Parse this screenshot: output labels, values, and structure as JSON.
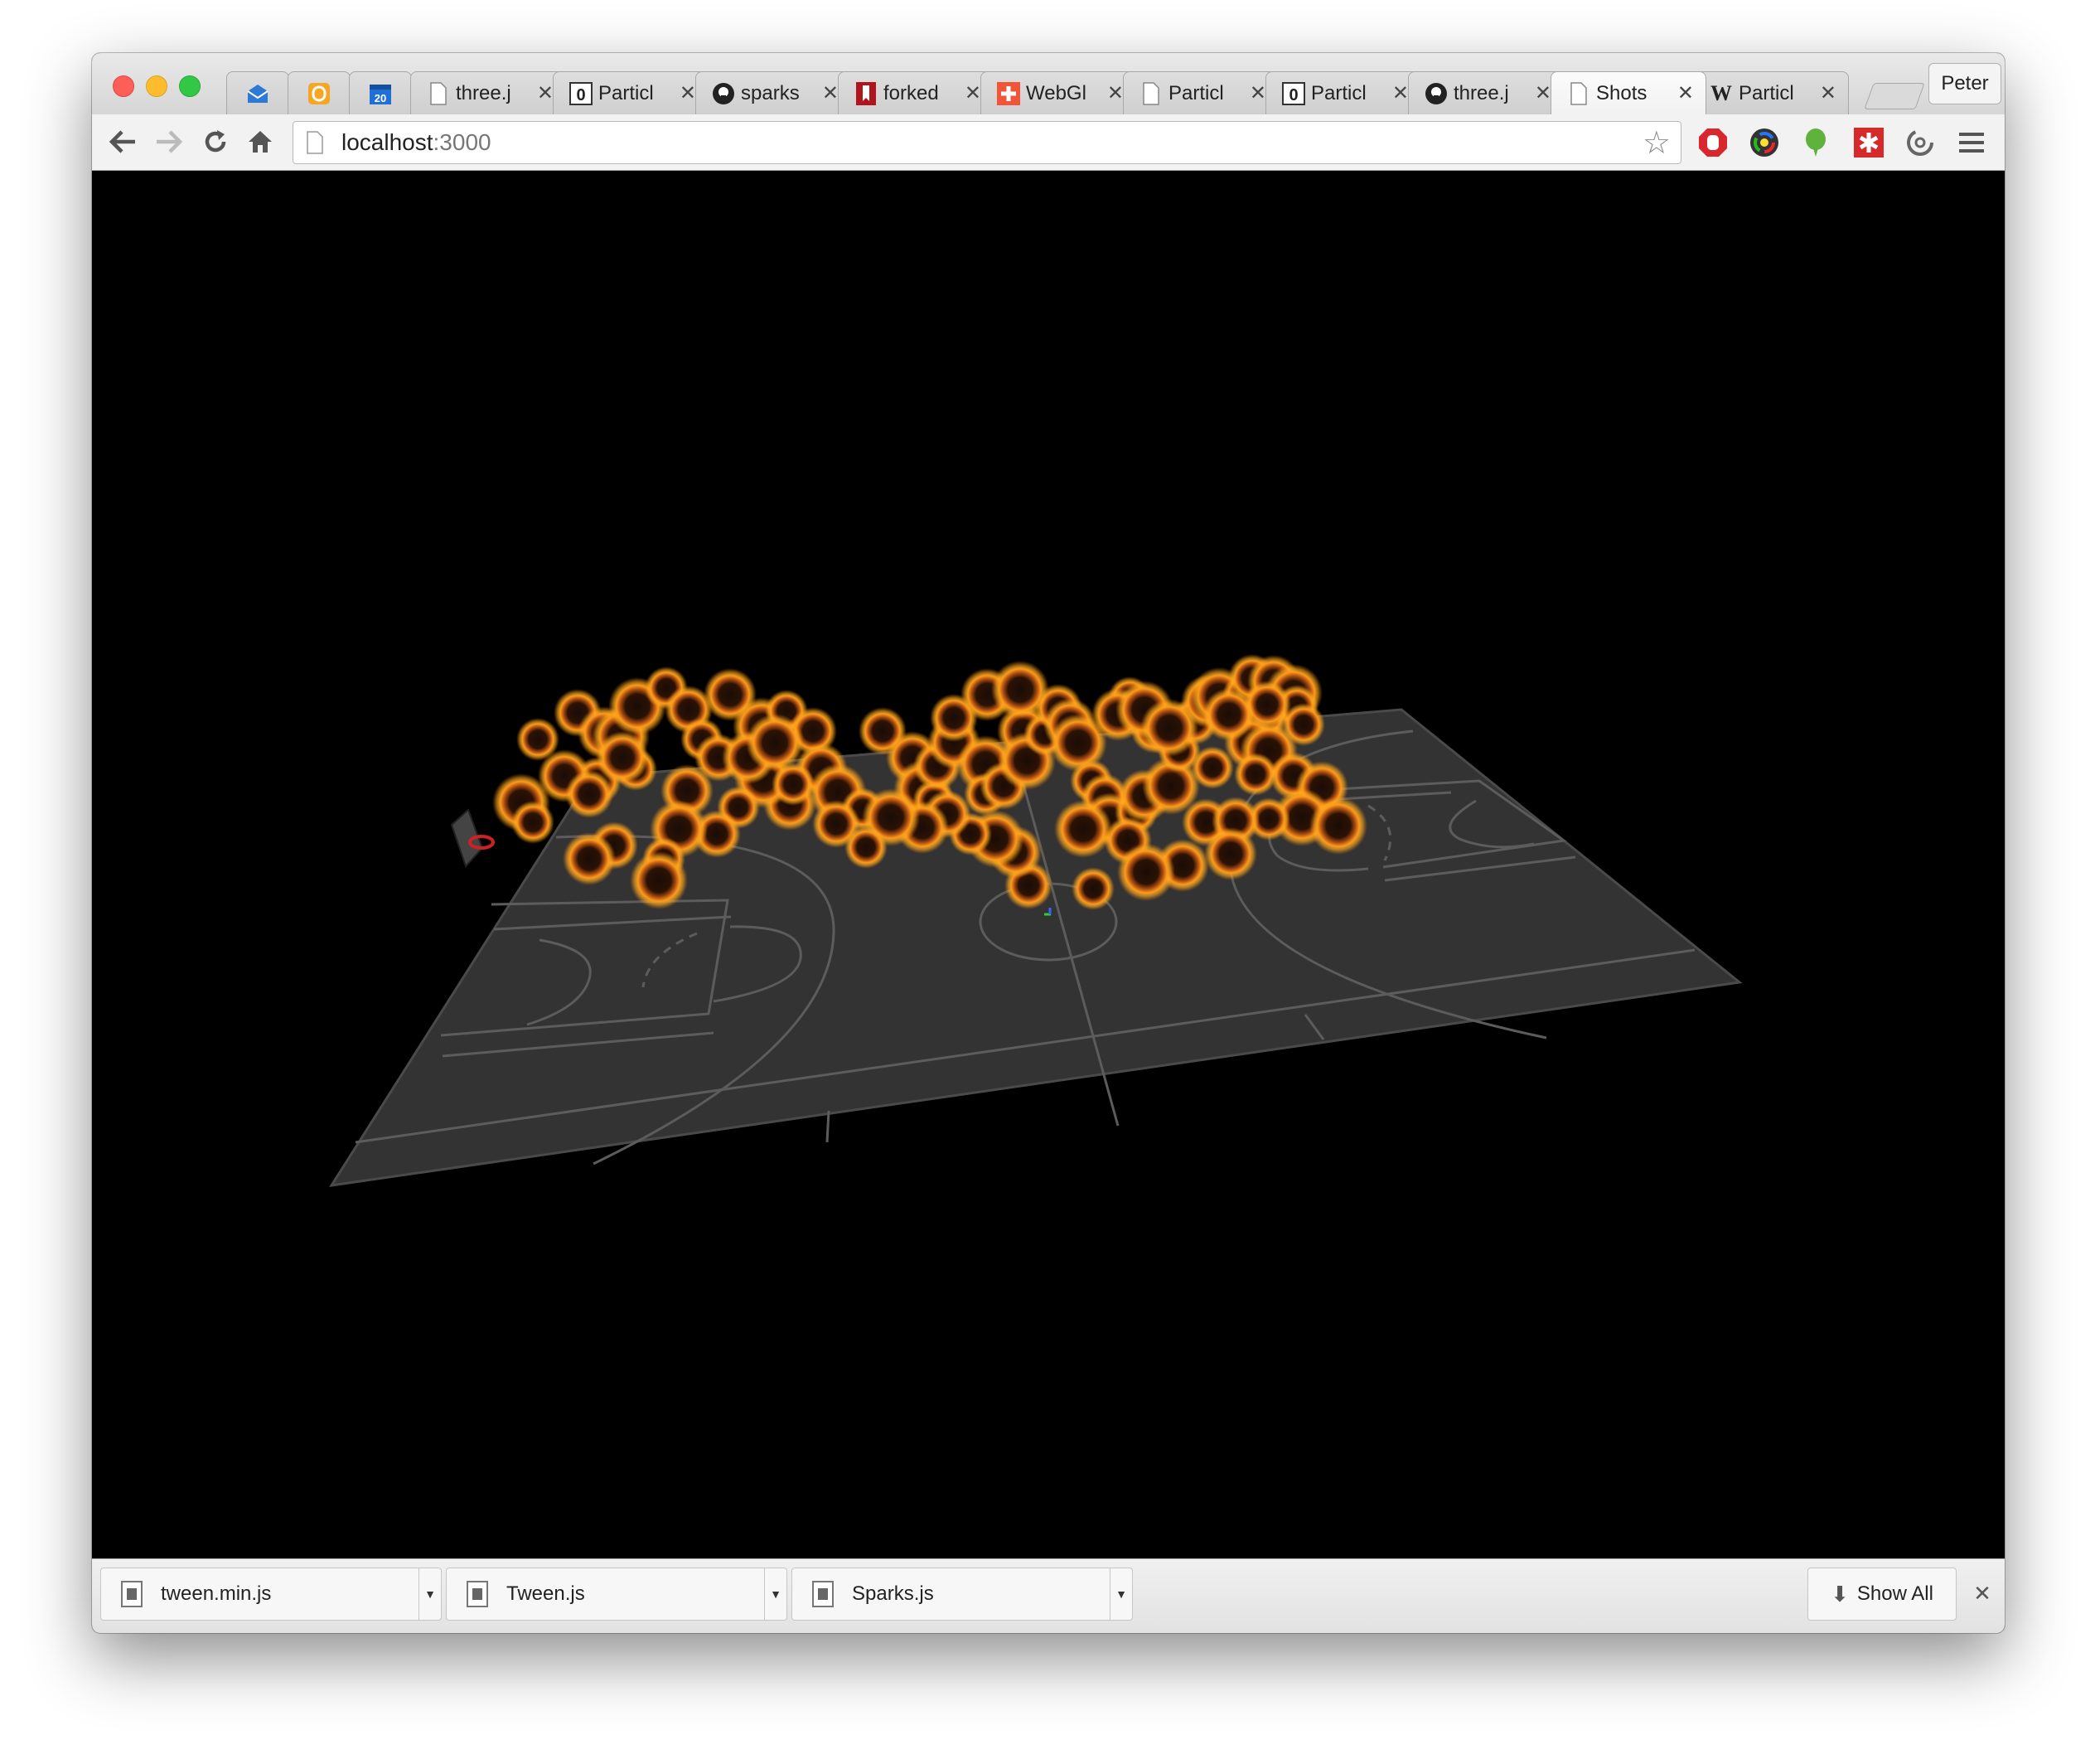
{
  "window": {
    "title": "Shots"
  },
  "tabs": [
    {
      "label": "",
      "icon": "mailbox-icon",
      "pinned": true,
      "color": "#2d7ad6"
    },
    {
      "label": "",
      "icon": "feedly-icon",
      "pinned": true,
      "color": "#f5a623"
    },
    {
      "label": "",
      "icon": "calendar-icon",
      "pinned": true,
      "color": "#1f6fd6",
      "badge": "20"
    },
    {
      "label": "three.j",
      "icon": "page-icon"
    },
    {
      "label": "Particl",
      "icon": "zero-icon"
    },
    {
      "label": "sparks",
      "icon": "github-icon"
    },
    {
      "label": "forked",
      "icon": "bookmark-red-icon"
    },
    {
      "label": "WebGl",
      "icon": "plus-red-icon"
    },
    {
      "label": "Particl",
      "icon": "page-icon"
    },
    {
      "label": "Particl",
      "icon": "zero-icon"
    },
    {
      "label": "three.j",
      "icon": "github-icon"
    },
    {
      "label": "Shots",
      "icon": "page-icon",
      "active": true
    },
    {
      "label": "Particl",
      "icon": "wikipedia-icon"
    }
  ],
  "profile": {
    "name": "Peter"
  },
  "toolbar": {
    "url_host": "localhost",
    "url_port": ":3000",
    "extensions": [
      "adblock-icon",
      "color-picker-icon",
      "evernote-icon",
      "asterisk-icon",
      "sync-icon",
      "menu-icon"
    ]
  },
  "scene": {
    "background": "#000000",
    "court_color": "#333333",
    "line_color": "#5c5c5c",
    "glow_color": "#ff9a1a",
    "hoop_color": "#cc2222"
  },
  "downloads": {
    "items": [
      {
        "name": "tween.min.js"
      },
      {
        "name": "Tween.js"
      },
      {
        "name": "Sparks.js"
      }
    ],
    "show_all": "Show All"
  }
}
